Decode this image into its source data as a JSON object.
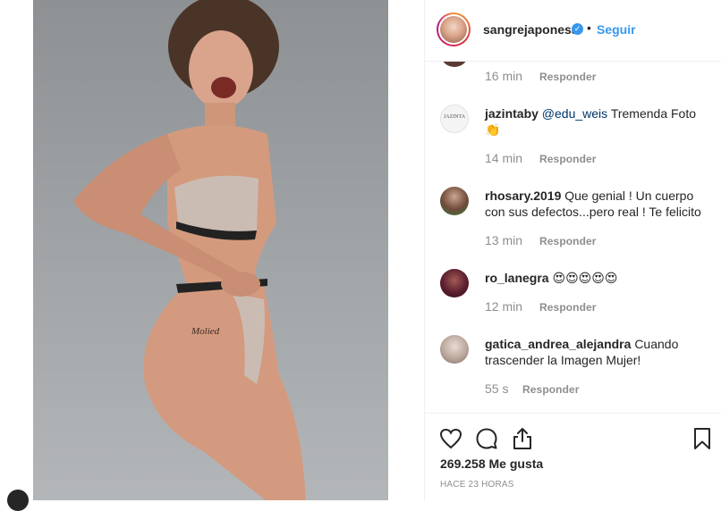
{
  "post": {
    "username": "sangrejaponesa",
    "verified_icon": "verified-badge-icon",
    "separator": "•",
    "follow_label": "Seguir",
    "tattoo_text": "Molied"
  },
  "comments": [
    {
      "user": "",
      "mention": "",
      "text": "",
      "time": "16 min",
      "reply": "Responder"
    },
    {
      "user": "jazintaby",
      "mention": "@edu_weis",
      "text": "Tremenda Foto 👏",
      "avatar_text": "JAZINTA",
      "time": "14 min",
      "reply": "Responder"
    },
    {
      "user": "rhosary.2019",
      "mention": "",
      "text": "Que genial ! Un cuerpo con sus defectos...pero real ! Te felicito",
      "time": "13 min",
      "reply": "Responder"
    },
    {
      "user": "ro_lanegra",
      "mention": "",
      "text": "😍😍😍😍😍",
      "time": "12 min",
      "reply": "Responder"
    },
    {
      "user": "gatica_andrea_alejandra",
      "mention": "",
      "text": "Cuando trascender la Imagen Mujer!",
      "time": "55 s",
      "reply": "Responder"
    }
  ],
  "actions": {
    "likes": "269.258 Me gusta",
    "time_ago": "HACE 23 HORAS",
    "icons": [
      "heart-icon",
      "comment-icon",
      "share-icon",
      "bookmark-icon"
    ]
  },
  "colors": {
    "link_blue": "#3897f0",
    "text": "#262626",
    "muted": "#8e8e8e"
  }
}
